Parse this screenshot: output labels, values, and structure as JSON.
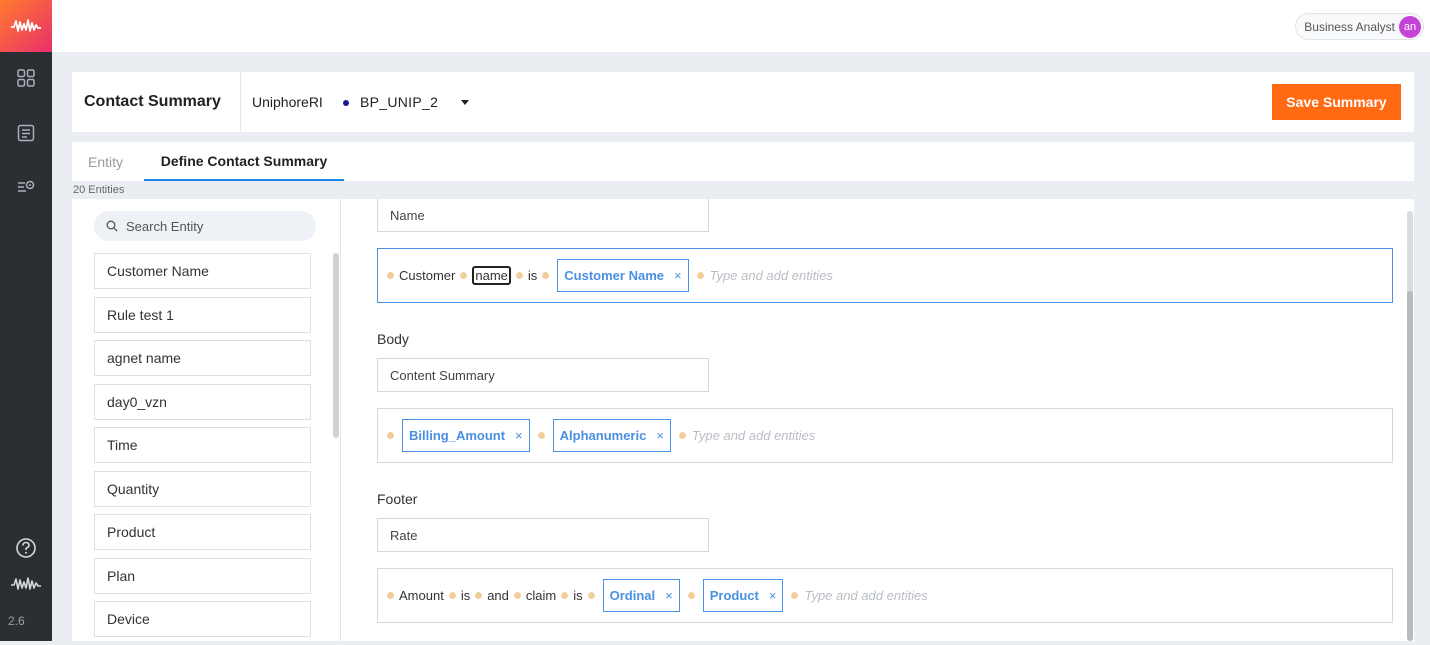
{
  "app": {
    "version": "2.6"
  },
  "user": {
    "role": "Business Analyst",
    "initials": "an"
  },
  "header": {
    "title": "Contact Summary",
    "org": "UniphoreRI",
    "project": "BP_UNIP_2",
    "save_label": "Save Summary"
  },
  "tabs": [
    {
      "label": "Entity",
      "active": false
    },
    {
      "label": "Define Contact Summary",
      "active": true
    }
  ],
  "entities_count": "20 Entities",
  "search": {
    "placeholder": "Search Entity"
  },
  "entities": [
    "Customer Name",
    "Rule test 1",
    "agnet name",
    "day0_vzn",
    "Time",
    "Quantity",
    "Product",
    "Plan",
    "Device"
  ],
  "sections": {
    "header": {
      "field_value": "Name",
      "tokens_text": [
        "Customer",
        "name",
        "is"
      ],
      "chips": [
        "Customer Name"
      ],
      "placeholder": "Type and add entities"
    },
    "body": {
      "label": "Body",
      "field_value": "Content Summary",
      "chips": [
        "Billing_Amount",
        "Alphanumeric"
      ],
      "placeholder": "Type and add entities"
    },
    "footer": {
      "label": "Footer",
      "field_value": "Rate",
      "tokens_text": [
        "Amount",
        "is",
        "and",
        "claim",
        "is"
      ],
      "chips": [
        "Ordinal",
        "Product"
      ],
      "placeholder": "Type and add entities"
    }
  },
  "remove_glyph": "×",
  "colors": {
    "accent": "#ff6a13",
    "chip": "#4a90e2",
    "rail": "#2b2f34",
    "avatar": "#c542d6"
  }
}
